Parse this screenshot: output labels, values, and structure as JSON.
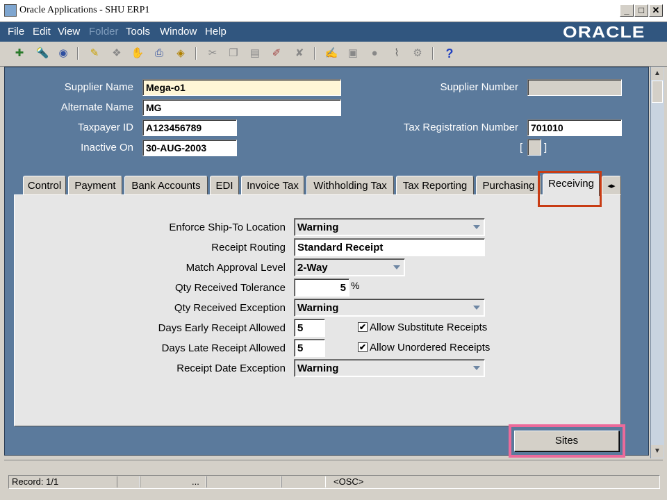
{
  "window": {
    "title": "Oracle Applications - SHU ERP1",
    "minimize": "_",
    "maximize": "□",
    "close": "✕"
  },
  "menu": {
    "items": [
      "File",
      "Edit",
      "View",
      "Folder",
      "Tools",
      "Window",
      "Help"
    ],
    "disabled": [
      "Folder"
    ],
    "logo": "ORACLE"
  },
  "toolbar": {
    "help": "?"
  },
  "header": {
    "supplier_name_label": "Supplier Name",
    "supplier_name": "Mega-o1",
    "alternate_name_label": "Alternate Name",
    "alternate_name": "MG",
    "taxpayer_id_label": "Taxpayer ID",
    "taxpayer_id": "A123456789",
    "inactive_on_label": "Inactive On",
    "inactive_on": "30-AUG-2003",
    "supplier_number_label": "Supplier Number",
    "supplier_number": "",
    "tax_reg_label": "Tax Registration Number",
    "tax_reg": "701010",
    "dff_open": "[",
    "dff_close": "]"
  },
  "tabs": [
    "Control",
    "Payment",
    "Bank Accounts",
    "EDI",
    "Invoice Tax",
    "Withholding Tax",
    "Tax Reporting",
    "Purchasing",
    "Receiving"
  ],
  "active_tab": "Receiving",
  "receiving": {
    "enforce_label": "Enforce Ship-To Location",
    "enforce": "Warning",
    "routing_label": "Receipt Routing",
    "routing": "Standard Receipt",
    "match_label": "Match Approval Level",
    "match": "2-Way",
    "tolerance_label": "Qty Received Tolerance",
    "tolerance": "5",
    "tolerance_unit": "%",
    "qty_exception_label": "Qty Received Exception",
    "qty_exception": "Warning",
    "early_label": "Days Early Receipt Allowed",
    "early": "5",
    "late_label": "Days Late Receipt Allowed",
    "late": "5",
    "date_exception_label": "Receipt Date Exception",
    "date_exception": "Warning",
    "allow_substitute_label": "Allow Substitute Receipts",
    "allow_substitute": true,
    "allow_unordered_label": "Allow Unordered Receipts",
    "allow_unordered": true
  },
  "buttons": {
    "sites": "Sites"
  },
  "status": {
    "record": "Record: 1/1",
    "ellipsis": "...",
    "osc": "<OSC>"
  },
  "colors": {
    "form_bg": "#5b7a9c",
    "menubar": "#31567f",
    "highlight_tab": "#c83c14",
    "highlight_button": "#ec6a9a",
    "required_field": "#fff6d6"
  }
}
